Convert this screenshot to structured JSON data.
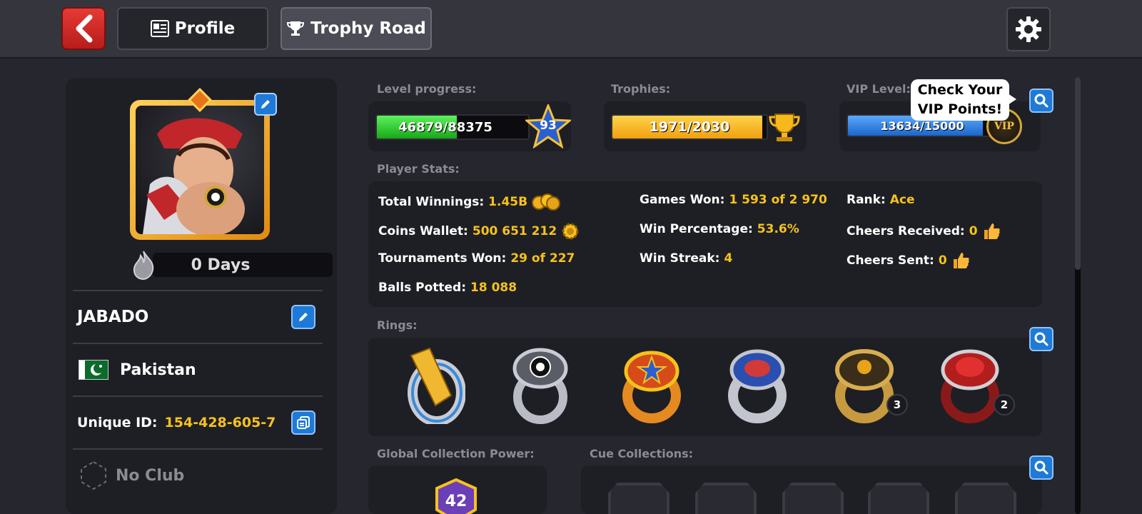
{
  "header": {
    "tabs": [
      {
        "label": "Profile",
        "icon": "profile-card-icon"
      },
      {
        "label": "Trophy Road",
        "icon": "trophy-icon"
      }
    ]
  },
  "profile": {
    "streak_label": "0 Days",
    "username": "JABADO",
    "country": "Pakistan",
    "unique_id_label": "Unique ID:",
    "unique_id": "154-428-605-7",
    "club": "No Club"
  },
  "progress": {
    "level_label": "Level progress:",
    "level_text": "46879/88375",
    "level_current": 46879,
    "level_max": 88375,
    "level_number": "93",
    "trophies_label": "Trophies:",
    "trophies_text": "1971/2030",
    "trophies_current": 1971,
    "trophies_max": 2030,
    "vip_label": "VIP Level:",
    "vip_text": "13634/15000",
    "vip_current": 13634,
    "vip_max": 15000,
    "vip_badge": "VIP",
    "tooltip_line1": "Check Your",
    "tooltip_line2": "VIP Points!"
  },
  "stats": {
    "label": "Player Stats:",
    "total_winnings_label": "Total Winnings:",
    "total_winnings": "1.45B",
    "coins_wallet_label": "Coins Wallet:",
    "coins_wallet": "500 651 212",
    "tournaments_won_label": "Tournaments Won:",
    "tournaments_won": "29 of 227",
    "balls_potted_label": "Balls Potted:",
    "balls_potted": "18 088",
    "games_won_label": "Games Won:",
    "games_won": "1 593 of 2 970",
    "win_percentage_label": "Win Percentage:",
    "win_percentage": "53.6%",
    "win_streak_label": "Win Streak:",
    "win_streak": "4",
    "rank_label": "Rank:",
    "rank": "Ace",
    "cheers_received_label": "Cheers Received:",
    "cheers_received": "0",
    "cheers_sent_label": "Cheers Sent:",
    "cheers_sent": "0"
  },
  "rings": {
    "label": "Rings:",
    "items": [
      {
        "name": "winstreak-ring",
        "count": ""
      },
      {
        "name": "master-ring",
        "count": ""
      },
      {
        "name": "legend-ring",
        "count": ""
      },
      {
        "name": "toronto-ring",
        "count": ""
      },
      {
        "name": "champions-ring",
        "count": "3"
      },
      {
        "name": "veteran-ring",
        "count": "2"
      }
    ]
  },
  "collection": {
    "global_label": "Global Collection Power:",
    "global_power": "42",
    "cue_label": "Cue Collections:"
  },
  "colors": {
    "accent_gold": "#f7c21b",
    "level_bar": "#2fd12f",
    "trophy_bar": "#f7b81b",
    "vip_bar": "#2e86e6"
  }
}
